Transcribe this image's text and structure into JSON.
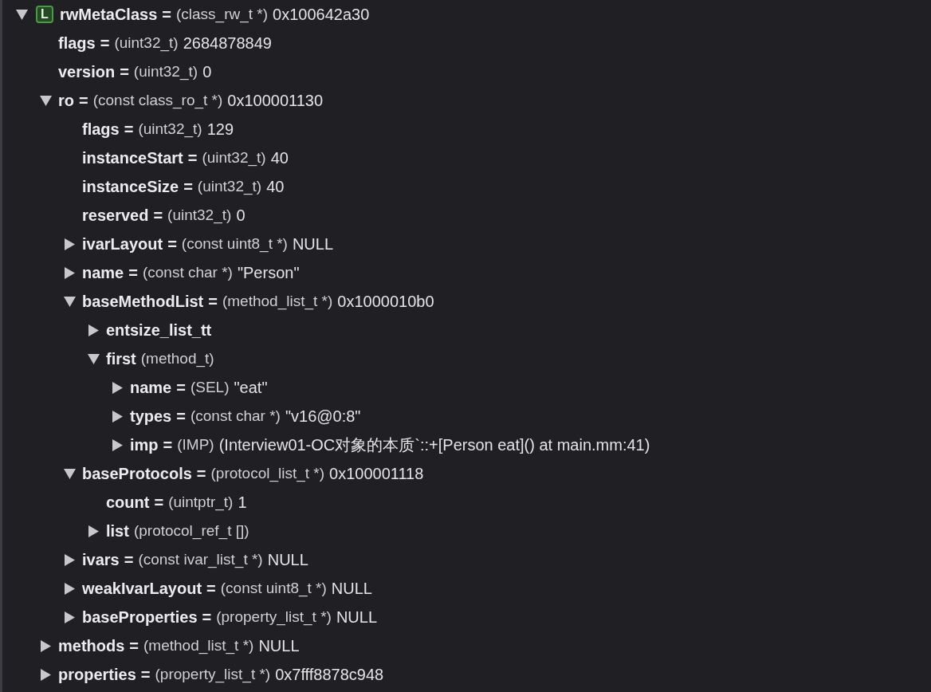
{
  "variables": [
    {
      "name": "rwMetaClass",
      "badge": "L",
      "separator": "=",
      "type": "(class_rw_t *)",
      "value": "0x100642a30",
      "expanded": true,
      "children": [
        {
          "name": "flags",
          "separator": "=",
          "type": "(uint32_t)",
          "value": "2684878849"
        },
        {
          "name": "version",
          "separator": "=",
          "type": "(uint32_t)",
          "value": "0"
        },
        {
          "name": "ro",
          "separator": "=",
          "type": "(const class_ro_t *)",
          "value": "0x100001130",
          "expanded": true,
          "children": [
            {
              "name": "flags",
              "separator": "=",
              "type": "(uint32_t)",
              "value": "129"
            },
            {
              "name": "instanceStart",
              "separator": "=",
              "type": "(uint32_t)",
              "value": "40"
            },
            {
              "name": "instanceSize",
              "separator": "=",
              "type": "(uint32_t)",
              "value": "40"
            },
            {
              "name": "reserved",
              "separator": "=",
              "type": "(uint32_t)",
              "value": "0"
            },
            {
              "name": "ivarLayout",
              "separator": "=",
              "type": "(const uint8_t *)",
              "value": "NULL",
              "expanded": false
            },
            {
              "name": "name",
              "separator": "=",
              "type": "(const char *)",
              "value": "\"Person\"",
              "expanded": false
            },
            {
              "name": "baseMethodList",
              "separator": "=",
              "type": "(method_list_t *)",
              "value": "0x1000010b0",
              "expanded": true,
              "children": [
                {
                  "name": "entsize_list_tt",
                  "expanded": false
                },
                {
                  "name": "first",
                  "type": "(method_t)",
                  "expanded": true,
                  "children": [
                    {
                      "name": "name",
                      "separator": "=",
                      "type": "(SEL)",
                      "value": "\"eat\"",
                      "expanded": false
                    },
                    {
                      "name": "types",
                      "separator": "=",
                      "type": "(const char *)",
                      "value": "\"v16@0:8\"",
                      "expanded": false
                    },
                    {
                      "name": "imp",
                      "separator": "=",
                      "type": "(IMP)",
                      "value": "(Interview01-OC对象的本质`::+[Person eat]() at main.mm:41)",
                      "expanded": false
                    }
                  ]
                }
              ]
            },
            {
              "name": "baseProtocols",
              "separator": "=",
              "type": "(protocol_list_t *)",
              "value": "0x100001118",
              "expanded": true,
              "children": [
                {
                  "name": "count",
                  "separator": "=",
                  "type": "(uintptr_t)",
                  "value": "1"
                },
                {
                  "name": "list",
                  "type": "(protocol_ref_t [])",
                  "expanded": false
                }
              ]
            },
            {
              "name": "ivars",
              "separator": "=",
              "type": "(const ivar_list_t *)",
              "value": "NULL",
              "expanded": false
            },
            {
              "name": "weakIvarLayout",
              "separator": "=",
              "type": "(const uint8_t *)",
              "value": "NULL",
              "expanded": false
            },
            {
              "name": "baseProperties",
              "separator": "=",
              "type": "(property_list_t *)",
              "value": "NULL",
              "expanded": false
            }
          ]
        },
        {
          "name": "methods",
          "separator": "=",
          "type": "(method_list_t *)",
          "value": "NULL",
          "expanded": false
        },
        {
          "name": "properties",
          "separator": "=",
          "type": "(property_list_t *)",
          "value": "0x7fff8878c948",
          "expanded": false
        }
      ]
    }
  ]
}
